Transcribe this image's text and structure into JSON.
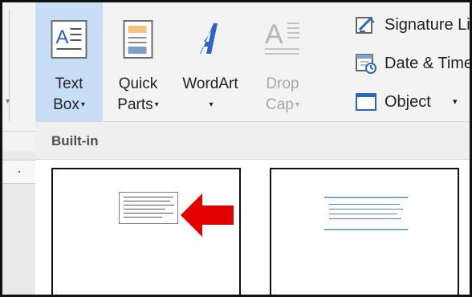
{
  "ribbon": {
    "commands": {
      "text_box": {
        "line1": "Text",
        "line2": "Box",
        "icon": "text-box-icon",
        "state": "selected"
      },
      "quick_parts": {
        "line1": "Quick",
        "line2": "Parts",
        "icon": "quick-parts-icon"
      },
      "wordart": {
        "line1": "WordArt",
        "line2": "",
        "icon": "wordart-icon"
      },
      "drop_cap": {
        "line1": "Drop",
        "line2": "Cap",
        "icon": "drop-cap-icon",
        "state": "disabled"
      }
    },
    "right_commands": [
      {
        "label": "Signature Line",
        "icon": "signature-line-icon"
      },
      {
        "label": "Date & Time",
        "icon": "calendar-clock-icon"
      },
      {
        "label": "Object",
        "icon": "object-icon"
      }
    ]
  },
  "gallery": {
    "section_title": "Built-in",
    "items": [
      {
        "name": "simple-text-box",
        "preview": "small text box preview"
      },
      {
        "name": "quote-text-box",
        "preview": "quote text box preview"
      }
    ]
  },
  "annotations": {
    "arrow": "red-arrow-icon",
    "arrow_color": "#e20000"
  },
  "colors": {
    "selected_command": "#c8def6",
    "ribbon_bg": "#f3f3f3",
    "disabled_text": "#a7a7a7",
    "builtin_header_bg": "#efefef",
    "quote_line": "#7aa7d4"
  }
}
